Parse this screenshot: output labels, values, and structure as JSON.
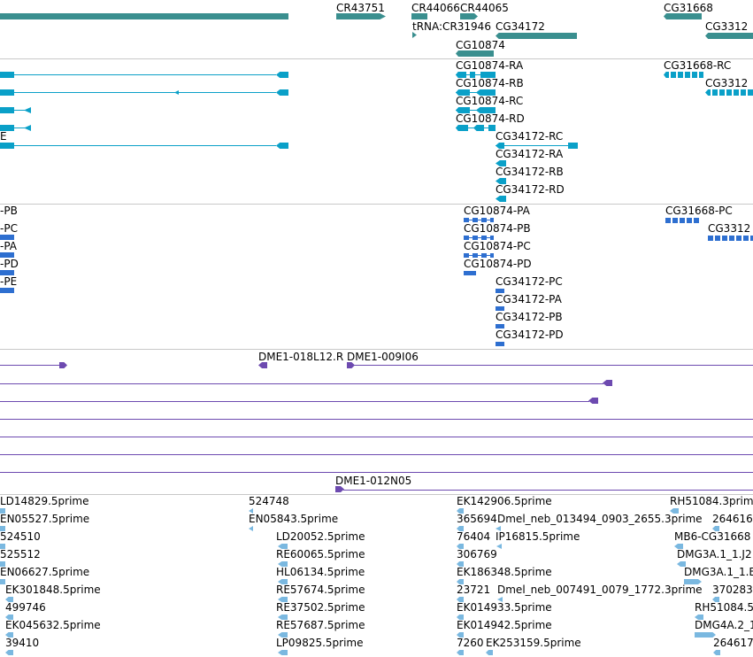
{
  "colors": {
    "gene": "#3a8f8f",
    "transcript": "#0aa0c8",
    "protein": "#2e6fd0",
    "clone": "#6d4ab0",
    "est": "#7ab8e0"
  },
  "tracks": {
    "gene_track": {
      "labels": [
        "CR43751",
        "CR44066",
        "CR44065",
        "tRNA:CR31946",
        "CG34172",
        "CG10874",
        "CG31668",
        "CG3312"
      ]
    },
    "transcript_track": {
      "labels": [
        "CG10874-RA",
        "CG10874-RB",
        "CG10874-RC",
        "CG10874-RD",
        "CG34172-RC",
        "CG34172-RA",
        "CG34172-RB",
        "CG34172-RD",
        "CG31668-RC",
        "CG3312",
        "E"
      ]
    },
    "protein_track": {
      "labels": [
        "-PB",
        "-PC",
        "-PA",
        "-PD",
        "-PE",
        "CG10874-PA",
        "CG10874-PB",
        "CG10874-PC",
        "CG10874-PD",
        "CG34172-PC",
        "CG34172-PA",
        "CG34172-PB",
        "CG34172-PD",
        "CG31668-PC",
        "CG3312"
      ]
    },
    "clone_track": {
      "labels": [
        "DME1-018L12.R",
        "DME1-009I06",
        "DME1-012N05"
      ]
    },
    "est_track": {
      "labels": [
        "LD14829.5prime",
        "EN05527.5prime",
        "524510",
        "525512",
        "EN06627.5prime",
        "EK301848.5prime",
        "499746",
        "EK045632.5prime",
        "39410",
        "524748",
        "EN05843.5prime",
        "LD20052.5prime",
        "RE60065.5prime",
        "HL06134.5prime",
        "RE57674.5prime",
        "RE37502.5prime",
        "RE57687.5prime",
        "LP09825.5prime",
        "EK142906.5prime",
        "365694",
        "Dmel_neb_013494_0903_2655.3prime",
        "76404",
        "IP16815.5prime",
        "306769",
        "EK186348.5prime",
        "23721",
        "Dmel_neb_007491_0079_1772.3prime",
        "EK014933.5prime",
        "EK014942.5prime",
        "7260",
        "EK253159.5prime",
        "RH51084.3prim",
        "264616",
        "MB6-CG31668",
        "DMG3A.1_1.J2",
        "DMG3A.1_1.B",
        "370283",
        "RH51084.5",
        "DMG4A.2_1",
        "264617"
      ]
    }
  }
}
